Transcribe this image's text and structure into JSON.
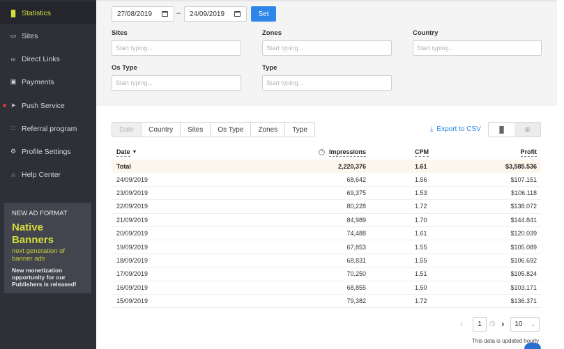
{
  "sidebar": {
    "items": [
      {
        "label": "Statistics",
        "icon": "bar-chart-icon",
        "glyph": "▐▌",
        "active": true
      },
      {
        "label": "Sites",
        "icon": "browser-window-icon",
        "glyph": "▭"
      },
      {
        "label": "Direct Links",
        "icon": "link-icon",
        "glyph": "∞"
      },
      {
        "label": "Payments",
        "icon": "wallet-icon",
        "glyph": "▣"
      },
      {
        "label": "Push Service",
        "icon": "send-icon",
        "glyph": "➤",
        "notification": true
      },
      {
        "label": "Referral program",
        "icon": "people-icon",
        "glyph": "∷"
      },
      {
        "label": "Profile Settings",
        "icon": "gear-icon",
        "glyph": "⚙"
      },
      {
        "label": "Help Center",
        "icon": "headphones-icon",
        "glyph": "∩"
      }
    ],
    "promo": {
      "kicker": "NEW AD FORMAT",
      "title_line1": "Native",
      "title_line2": "Banners",
      "subtitle": "next generation of banner ads",
      "description": "New monetization opportunity for our Publishers is released!"
    }
  },
  "filters": {
    "date_from": "27/08/2019",
    "date_to": "24/09/2019",
    "separator": "–",
    "set_label": "Set",
    "fields": [
      {
        "label": "Sites",
        "placeholder": "Start typing..."
      },
      {
        "label": "Zones",
        "placeholder": "Start typing..."
      },
      {
        "label": "Country",
        "placeholder": "Start typing..."
      },
      {
        "label": "Os Type",
        "placeholder": "Start typing..."
      },
      {
        "label": "Type",
        "placeholder": "Start typing..."
      }
    ]
  },
  "group_tabs": [
    "Date",
    "Country",
    "Sites",
    "Os Type",
    "Zones",
    "Type"
  ],
  "export_label": "Export to CSV",
  "view_toggle": {
    "chart_glyph": "▐▌",
    "table_glyph": "⊞"
  },
  "table": {
    "headers": {
      "date": "Date",
      "impressions": "Impressions",
      "cpm": "CPM",
      "profit": "Profit"
    },
    "total": {
      "label": "Total",
      "impressions": "2,220,376",
      "cpm": "1.61",
      "profit": "$3,585.536"
    },
    "rows": [
      {
        "date": "24/09/2019",
        "impressions": "68,642",
        "cpm": "1.56",
        "profit": "$107.151"
      },
      {
        "date": "23/09/2019",
        "impressions": "69,375",
        "cpm": "1.53",
        "profit": "$106.118"
      },
      {
        "date": "22/09/2019",
        "impressions": "80,228",
        "cpm": "1.72",
        "profit": "$138.072"
      },
      {
        "date": "21/09/2019",
        "impressions": "84,989",
        "cpm": "1.70",
        "profit": "$144.841"
      },
      {
        "date": "20/09/2019",
        "impressions": "74,488",
        "cpm": "1.61",
        "profit": "$120.039"
      },
      {
        "date": "19/09/2019",
        "impressions": "67,853",
        "cpm": "1.55",
        "profit": "$105.089"
      },
      {
        "date": "18/09/2019",
        "impressions": "68,831",
        "cpm": "1.55",
        "profit": "$106.692"
      },
      {
        "date": "17/09/2019",
        "impressions": "70,250",
        "cpm": "1.51",
        "profit": "$105.824"
      },
      {
        "date": "16/09/2019",
        "impressions": "68,855",
        "cpm": "1.50",
        "profit": "$103.171"
      },
      {
        "date": "15/09/2019",
        "impressions": "79,382",
        "cpm": "1.72",
        "profit": "$136.371"
      }
    ]
  },
  "pagination": {
    "current_page": "1",
    "total_pages": "/3",
    "page_size": "10"
  },
  "footer_note": "This data is updated hourly",
  "colors": {
    "accent": "#2c87e8",
    "sidebar_bg": "#2e3038",
    "active_text": "#d7dc3d",
    "total_row_bg": "#fdf6ec",
    "notification_dot": "#d3364a"
  }
}
